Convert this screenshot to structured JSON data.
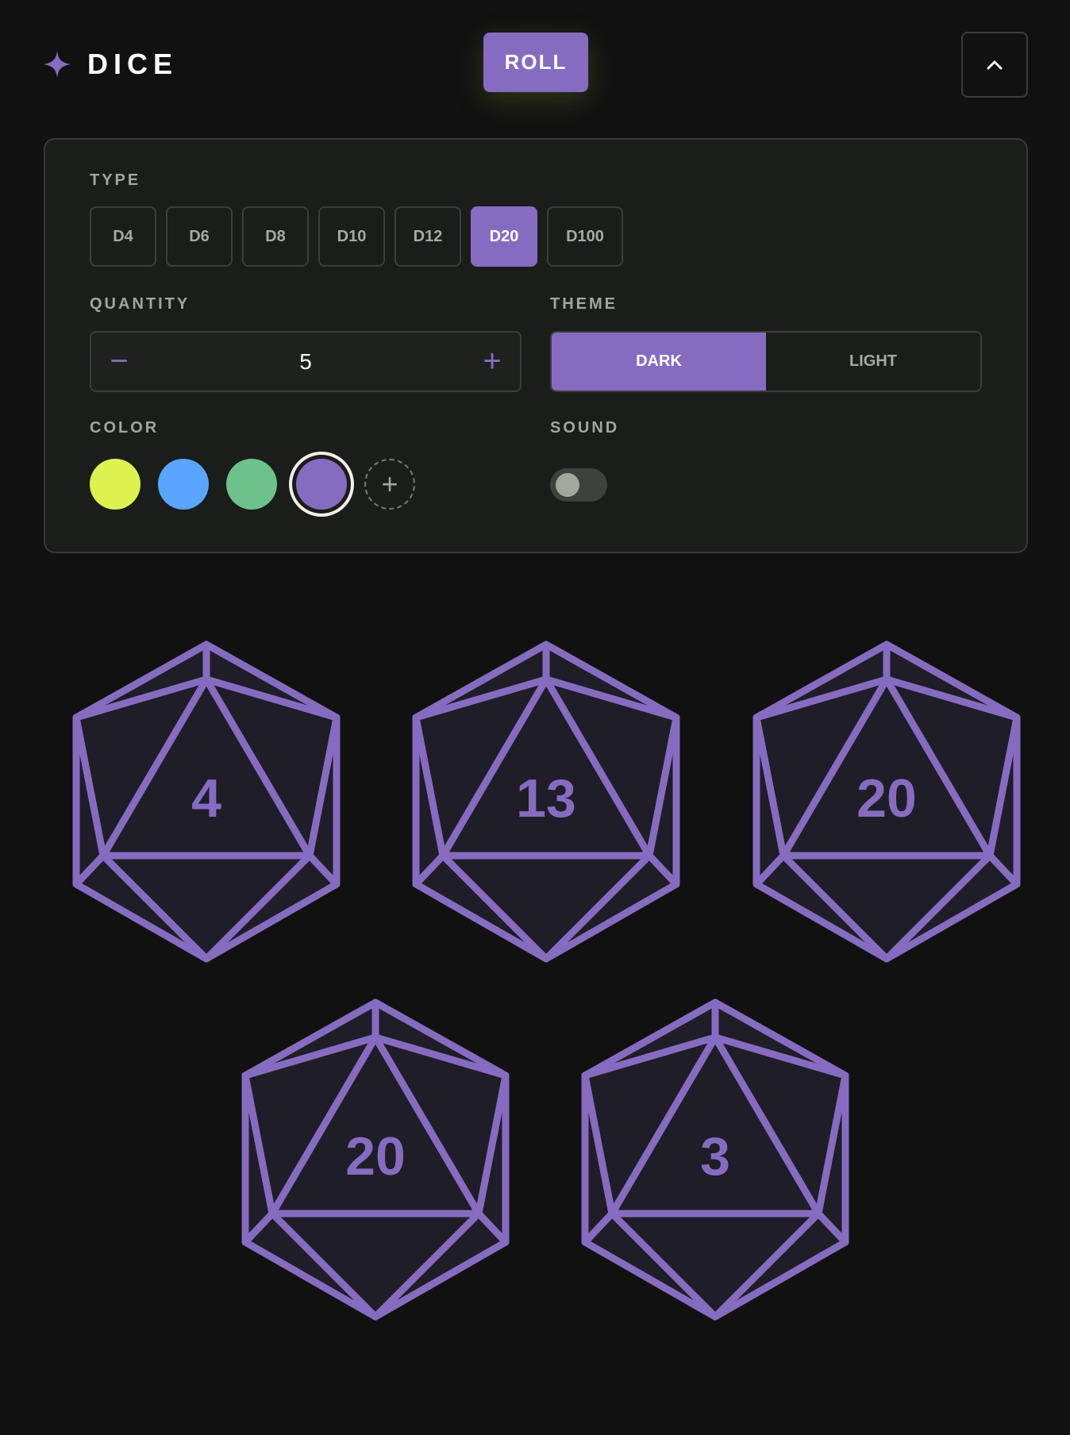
{
  "header": {
    "logo_text": "DICE",
    "logo_icon": "sparkle-icon",
    "roll_label": "ROLL",
    "collapse_icon": "chevron-up-icon"
  },
  "panel": {
    "type_label": "TYPE",
    "types": [
      "D4",
      "D6",
      "D8",
      "D10",
      "D12",
      "D20",
      "D100"
    ],
    "selected_type": "D20",
    "quantity_label": "QUANTITY",
    "quantity_minus": "−",
    "quantity_value": "5",
    "quantity_plus": "+",
    "theme_label": "THEME",
    "theme_options": [
      "DARK",
      "LIGHT"
    ],
    "selected_theme": "DARK",
    "color_label": "COLOR",
    "colors": [
      "#dcf24f",
      "#5aa6ff",
      "#6cc28a",
      "#866cc0"
    ],
    "selected_color": "#866cc0",
    "add_color_icon": "plus-icon",
    "add_color_text": "+",
    "sound_label": "SOUND",
    "sound_enabled": false
  },
  "dice": {
    "type": "D20",
    "values": [
      "4",
      "13",
      "20",
      "20",
      "3"
    ]
  },
  "colors": {
    "accent": "#866cc0",
    "background": "#111111",
    "panel": "#1b1d1a"
  }
}
